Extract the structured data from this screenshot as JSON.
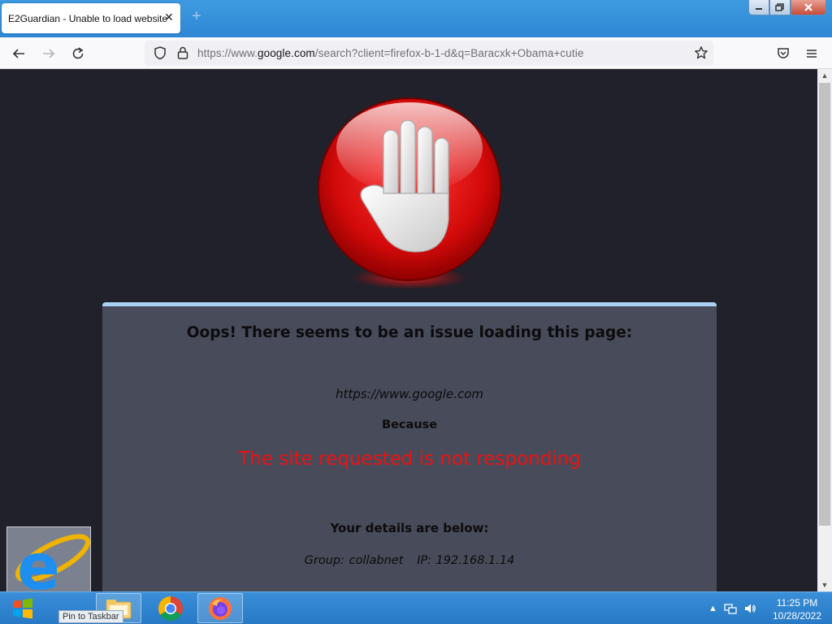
{
  "browser": {
    "tab_title": "E2Guardian - Unable to load website",
    "tab_close": "✕",
    "new_tab": "+",
    "url_prefix": "https://www.",
    "url_domain": "google.com",
    "url_rest": "/search?client=firefox-b-1-d&q=Baracxk+Obama+cutie"
  },
  "page": {
    "heading": "Oops! There seems to be an issue loading this page:",
    "blocked_url": "https://www.google.com",
    "because": "Because",
    "reason": "The site requested is not responding",
    "details_heading": "Your details are below:",
    "details": "Group: collabnet   IP: 192.168.1.14"
  },
  "taskbar": {
    "tooltip": "Pin to Taskbar",
    "time": "11:25 PM",
    "date": "10/28/2022"
  },
  "colors": {
    "titlebar": "#2f86d3",
    "reason_text": "#ee1111",
    "panel_bg": "#474b5a",
    "panel_accent": "#a9d2f7",
    "page_bg": "#20212a"
  },
  "icons": [
    "back-icon",
    "forward-icon",
    "reload-icon",
    "shield-icon",
    "lock-icon",
    "star-icon",
    "pocket-icon",
    "menu-icon",
    "windows-logo-icon",
    "file-explorer-icon",
    "chrome-icon",
    "firefox-icon",
    "internet-explorer-icon",
    "network-icon",
    "volume-icon"
  ]
}
